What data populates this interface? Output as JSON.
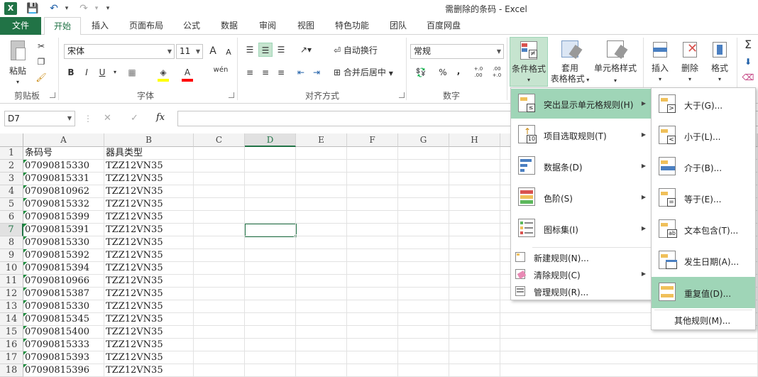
{
  "window": {
    "title": "需删除的条码 - Excel",
    "app_icon": "X"
  },
  "qat": {
    "save_icon": "save-icon",
    "undo_icon": "undo-icon",
    "redo_icon": "redo-icon",
    "more_icon": "qat-more-icon"
  },
  "tabs": [
    "文件",
    "开始",
    "插入",
    "页面布局",
    "公式",
    "数据",
    "审阅",
    "视图",
    "特色功能",
    "团队",
    "百度网盘"
  ],
  "ribbon": {
    "clipboard": {
      "paste": "粘贴",
      "label": "剪贴板"
    },
    "font": {
      "name": "宋体",
      "size": "11",
      "grow": "A",
      "shrink": "A",
      "bold": "B",
      "italic": "I",
      "underline": "U",
      "phonetic": "wén",
      "color_letter": "A",
      "label": "字体"
    },
    "alignment": {
      "wrap": "自动换行",
      "merge": "合并后居中",
      "label": "对齐方式"
    },
    "number": {
      "format": "常规",
      "percent": "%",
      "comma": ",",
      "inc": "+.0 .00",
      "dec": ".00 +.0",
      "label": "数字"
    },
    "styles": {
      "conditional": "条件格式",
      "table_1": "套用",
      "table_2": "表格格式",
      "cell_styles": "单元格样式"
    },
    "cells": {
      "insert": "插入",
      "delete": "删除",
      "format": "格式"
    }
  },
  "formula_bar": {
    "name_box": "D7",
    "cancel": "✕",
    "enter": "✓",
    "fx": "fx",
    "value": ""
  },
  "columns": [
    "A",
    "B",
    "C",
    "D",
    "E",
    "F",
    "G",
    "H"
  ],
  "rows": [
    {
      "n": "1",
      "a": "条码号",
      "b": "器具类型"
    },
    {
      "n": "2",
      "a": "07090815330",
      "b": "TZZ12VN35"
    },
    {
      "n": "3",
      "a": "07090815331",
      "b": "TZZ12VN35"
    },
    {
      "n": "4",
      "a": "07090810962",
      "b": "TZZ12VN35"
    },
    {
      "n": "5",
      "a": "07090815332",
      "b": "TZZ12VN35"
    },
    {
      "n": "6",
      "a": "07090815399",
      "b": "TZZ12VN35"
    },
    {
      "n": "7",
      "a": "07090815391",
      "b": "TZZ12VN35"
    },
    {
      "n": "8",
      "a": "07090815330",
      "b": "TZZ12VN35"
    },
    {
      "n": "9",
      "a": "07090815392",
      "b": "TZZ12VN35"
    },
    {
      "n": "10",
      "a": "07090815394",
      "b": "TZZ12VN35"
    },
    {
      "n": "11",
      "a": "07090810966",
      "b": "TZZ12VN35"
    },
    {
      "n": "12",
      "a": "07090815387",
      "b": "TZZ12VN35"
    },
    {
      "n": "13",
      "a": "07090815330",
      "b": "TZZ12VN35"
    },
    {
      "n": "14",
      "a": "07090815345",
      "b": "TZZ12VN35"
    },
    {
      "n": "15",
      "a": "07090815400",
      "b": "TZZ12VN35"
    },
    {
      "n": "16",
      "a": "07090815333",
      "b": "TZZ12VN35"
    },
    {
      "n": "17",
      "a": "07090815393",
      "b": "TZZ12VN35"
    },
    {
      "n": "18",
      "a": "07090815396",
      "b": "TZZ12VN35"
    }
  ],
  "cf_menu": {
    "items": [
      {
        "label": "突出显示单元格规则(H)",
        "icon": "highlight-rules-icon"
      },
      {
        "label": "项目选取规则(T)",
        "icon": "top-bottom-rules-icon"
      },
      {
        "label": "数据条(D)",
        "icon": "data-bars-icon"
      },
      {
        "label": "色阶(S)",
        "icon": "color-scales-icon"
      },
      {
        "label": "图标集(I)",
        "icon": "icon-sets-icon"
      }
    ],
    "small_items": [
      {
        "label": "新建规则(N)...",
        "icon": "new-rule-icon"
      },
      {
        "label": "清除规则(C)",
        "icon": "clear-rules-icon"
      },
      {
        "label": "管理规则(R)...",
        "icon": "manage-rules-icon"
      }
    ]
  },
  "sub_menu": {
    "items": [
      {
        "label": "大于(G)...",
        "icon": "greater-than-icon",
        "glyph": ">"
      },
      {
        "label": "小于(L)...",
        "icon": "less-than-icon",
        "glyph": "<"
      },
      {
        "label": "介于(B)...",
        "icon": "between-icon",
        "glyph": ""
      },
      {
        "label": "等于(E)...",
        "icon": "equal-to-icon",
        "glyph": "="
      },
      {
        "label": "文本包含(T)...",
        "icon": "text-contains-icon",
        "glyph": "ab"
      },
      {
        "label": "发生日期(A)...",
        "icon": "date-occurring-icon",
        "glyph": ""
      },
      {
        "label": "重复值(D)...",
        "icon": "duplicate-values-icon",
        "glyph": ""
      }
    ],
    "more": "其他规则(M)..."
  },
  "colors": {
    "accent": "#217346",
    "menu_highlight": "#9fd5b7",
    "error_triangle": "#1e8e3e"
  }
}
